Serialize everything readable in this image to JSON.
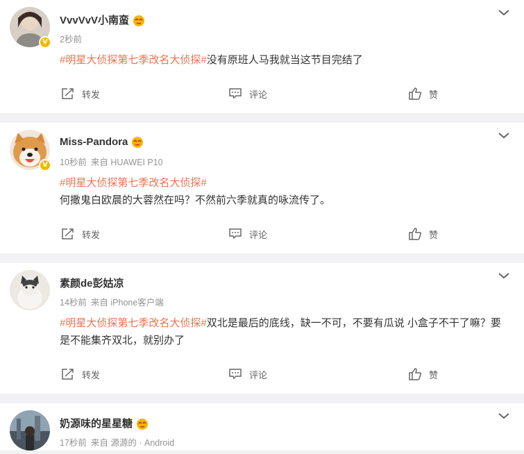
{
  "posts": [
    {
      "name": "VvvVvV小南蛮",
      "time": "2秒前",
      "source": "",
      "topic": "#明星大侦探第七季改名大侦探#",
      "text": "没有原班人马我就当这节目完结了",
      "avatar_color": "#b7a99c"
    },
    {
      "name": "Miss-Pandora",
      "time": "10秒前",
      "source": "来自 HUAWEI P10",
      "topic": "#明星大侦探第七季改名大侦探#",
      "text": "何撒鬼白欧晨的大蓉然在吗？不然前六季就真的咏流传了。",
      "avatar_color": "#e0a45c"
    },
    {
      "name": "素颜de彭姑凉",
      "time": "14秒前",
      "source": "来自 iPhone客户端",
      "topic": "#明星大侦探第七季改名大侦探#",
      "text": "双北是最后的底线，缺一不可，不要有瓜说 小盒子不干了嘛？要是不能集齐双北，就别办了",
      "avatar_color": "#c9c4bd"
    },
    {
      "name": "奶源味的星星糖",
      "time": "17秒前",
      "source": "来自 源源的 · Android",
      "topic": "",
      "text": "",
      "avatar_color": "#5a6470"
    }
  ],
  "actions": {
    "forward": "转发",
    "comment": "评论",
    "like": "赞"
  },
  "colors": {
    "topic": "#eb7350",
    "badge": "#f5b700"
  },
  "icons": [
    "chevron-down-icon",
    "forward-icon",
    "comment-icon",
    "like-icon",
    "verified-badge-icon",
    "fan-medal-icon"
  ]
}
